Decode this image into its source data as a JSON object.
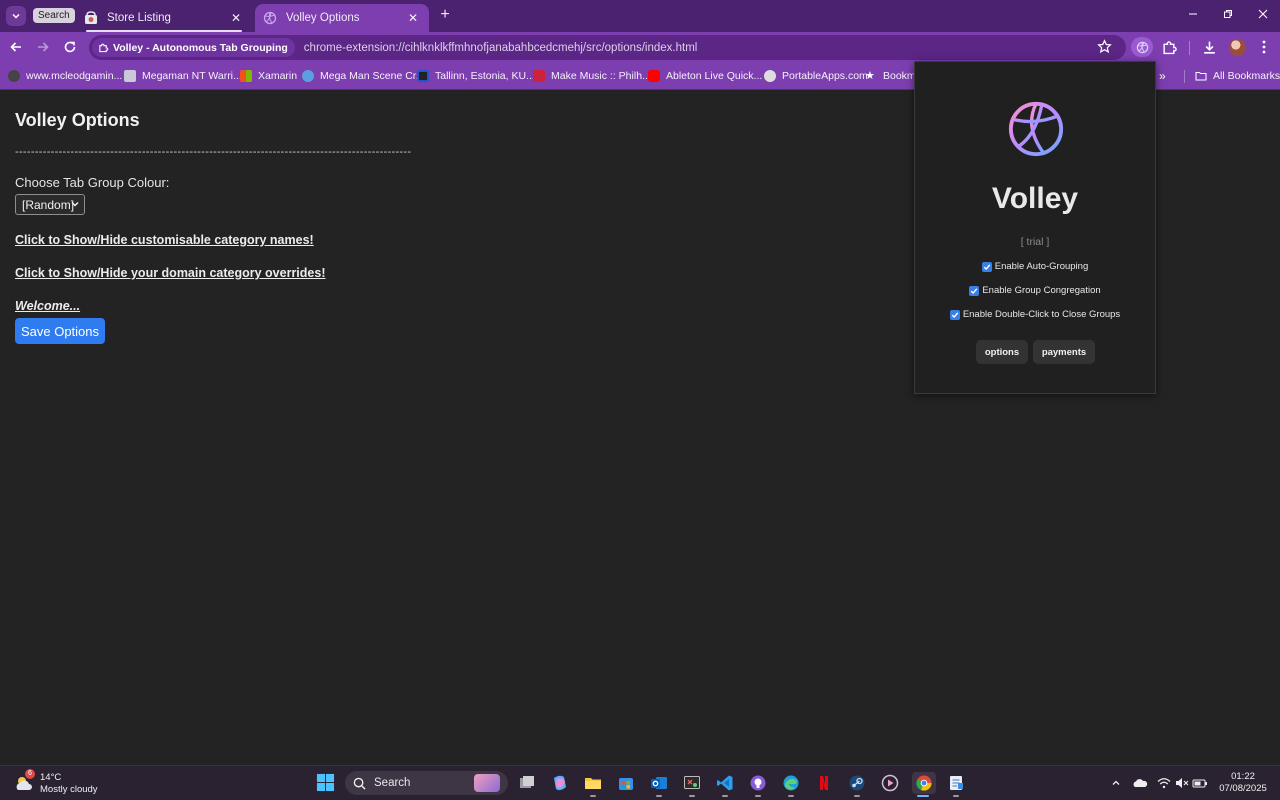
{
  "browser": {
    "tab_search_chip": "Search",
    "tabs": [
      {
        "label": "Store Listing",
        "state": "inactive"
      },
      {
        "label": "Volley Options",
        "state": "active"
      }
    ],
    "address": {
      "site_chip": "Volley - Autonomous Tab Grouping",
      "url": "chrome-extension://cihlknklkffmhnofjanabahbcedcmehj/src/options/index.html"
    },
    "bookmarks": [
      {
        "label": "www.mcleodgamin...",
        "color": "#3a3a3a"
      },
      {
        "label": "Megaman NT Warri...",
        "color": "#c9c9d8"
      },
      {
        "label": "Xamarin",
        "color": "#f25022"
      },
      {
        "label": "Mega Man Scene Cr...",
        "color": "#5aa0e0"
      },
      {
        "label": "Tallinn, Estonia, KU...",
        "color": "#2255cc"
      },
      {
        "label": "Make Music :: Philh...",
        "color": "#d0213c"
      },
      {
        "label": "Ableton Live Quick...",
        "color": "#ff0000"
      },
      {
        "label": "PortableApps.com",
        "color": "#dddddd"
      },
      {
        "label": "Bookma",
        "color": "#ffffff"
      }
    ],
    "all_bookmarks": "All Bookmarks",
    "more_bookmarks": "»"
  },
  "options_page": {
    "title": "Volley Options",
    "divider": "----------------------------------------------------------------------------------------------------",
    "colour_label": "Choose Tab Group Colour:",
    "colour_value": "[Random]",
    "category_names_link": "Click to Show/Hide customisable category names!",
    "domain_overrides_link": "Click to Show/Hide your domain category overrides!",
    "welcome_link": "Welcome...",
    "save_button": "Save Options"
  },
  "popup": {
    "title": "Volley",
    "subtitle": "[ trial ]",
    "options": [
      {
        "label": "Enable Auto-Grouping",
        "checked": true
      },
      {
        "label": "Enable Group Congregation",
        "checked": true
      },
      {
        "label": "Enable Double-Click to Close Groups",
        "checked": true
      }
    ],
    "options_button": "options",
    "payments_button": "payments"
  },
  "taskbar": {
    "weather_temp": "14°C",
    "weather_desc": "Mostly cloudy",
    "weather_badge": "6",
    "search_label": "Search",
    "apps": [
      "task-view",
      "copilot",
      "file-explorer",
      "microsoft-store",
      "outlook",
      "snipping-tool",
      "vs-code",
      "github-desktop",
      "edge",
      "netflix",
      "steam",
      "media-player",
      "chrome",
      "notepad"
    ],
    "clock_time": "01:22",
    "clock_date": "07/08/2025"
  },
  "colors": {
    "tab_strip": "#4a2270",
    "toolbar": "#7d3fb0",
    "accent_blue": "#2f7cf0",
    "page_bg": "#232323"
  }
}
